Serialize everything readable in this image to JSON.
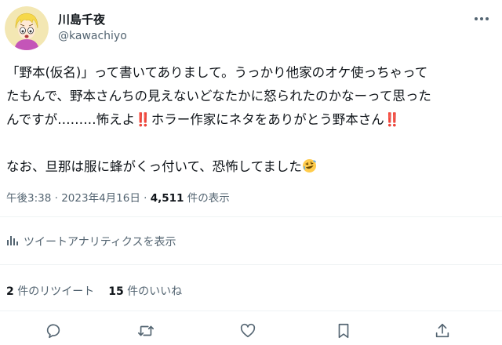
{
  "author": {
    "name": "川島千夜",
    "handle": "@kawachiyo"
  },
  "tweet": {
    "paragraph1": {
      "lines": [
        "「野本(仮名)」って書いてありまして。うっかり他家のオケ使っちゃって",
        "たもんで、野本さんちの見えないどなたかに怒られたのかなーって思った"
      ],
      "line3_a": "んですが………怖えよ",
      "mark": "‼️",
      "line3_b": "ホラー作家にネタをありがとう野本さん"
    },
    "paragraph2": "なお、旦那は服に蜂がくっ付いて、恐怖してました",
    "emoji_name": "rolling-on-floor-laughing-emoji"
  },
  "meta": {
    "time": "午後3:38",
    "separator": "·",
    "date": "2023年4月16日",
    "views_count": "4,511",
    "views_label": "件の表示"
  },
  "analytics_label": "ツイートアナリティクスを表示",
  "stats": {
    "retweets_count": "2",
    "retweets_label": "件のリツイート",
    "likes_count": "15",
    "likes_label": "件のいいね"
  },
  "actions": [
    "reply-icon",
    "retweet-icon",
    "like-icon",
    "bookmark-icon",
    "share-icon"
  ],
  "colors": {
    "text": "#0f1419",
    "secondary": "#536471",
    "divider": "#eff3f4",
    "avatar_bg": "#f3e7b3",
    "emphasis": "#e0245e"
  }
}
